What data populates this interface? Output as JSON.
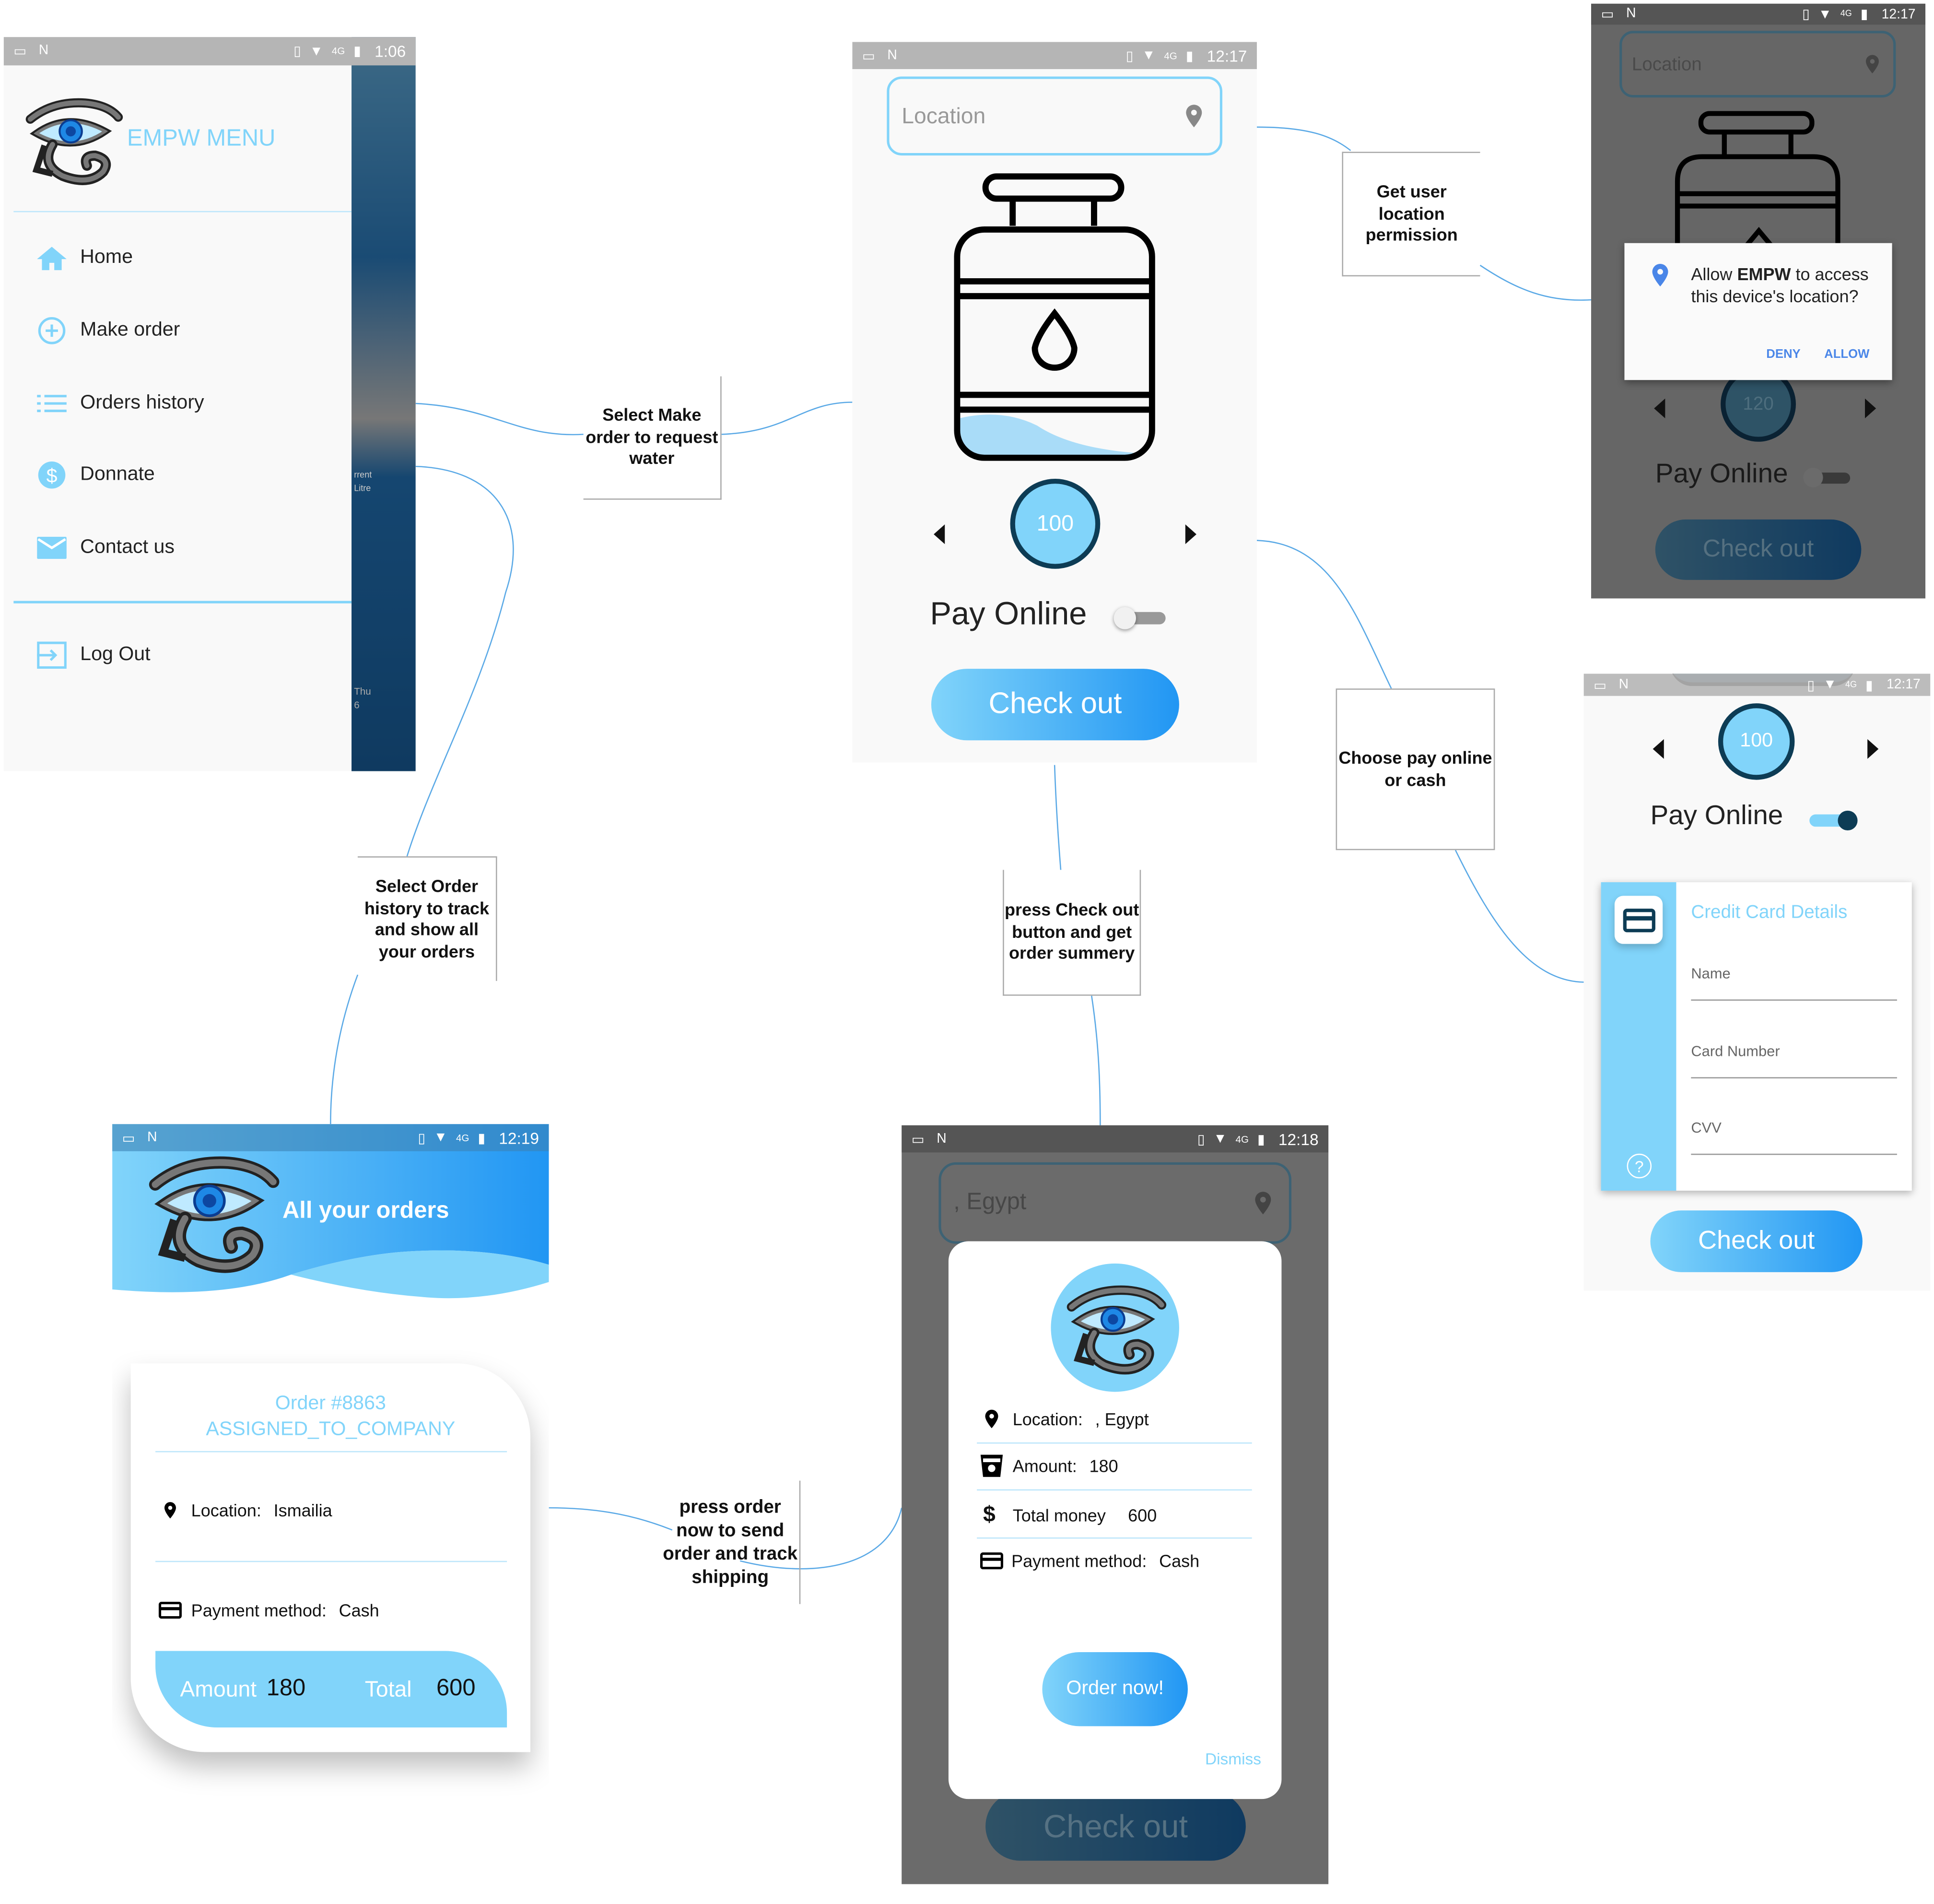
{
  "colors": {
    "accent": "#81d4fa",
    "primary": "#2196f3",
    "dark": "#0d3c55",
    "connector": "#5aa9e6",
    "overlay": "#666666"
  },
  "menu_screen": {
    "status": {
      "time": "1:06",
      "network": "4G"
    },
    "title": "EMPW MENU",
    "items": [
      {
        "label": "Home",
        "icon": "home-icon"
      },
      {
        "label": "Make order",
        "icon": "plus-circle-icon"
      },
      {
        "label": "Orders history",
        "icon": "list-icon"
      },
      {
        "label": "Donnate",
        "icon": "dollar-icon"
      },
      {
        "label": "Contact us",
        "icon": "mail-icon"
      }
    ],
    "logout": "Log Out",
    "background_peek": {
      "line1": "rrent",
      "line2": "Litre",
      "day": "Thu",
      "date": "6"
    }
  },
  "order_screen": {
    "status": {
      "time": "12:17",
      "network": "4G"
    },
    "location_placeholder": "Location",
    "quantity": "100",
    "pay_online_label": "Pay Online",
    "pay_online_on": false,
    "checkout": "Check out"
  },
  "permission_screen": {
    "status": {
      "time": "12:17",
      "network": "4G"
    },
    "location_placeholder": "Location",
    "quantity": "120",
    "pay_online_label": "Pay Online",
    "checkout": "Check out",
    "dialog": {
      "prefix": "Allow ",
      "app": "EMPW",
      "suffix": " to access this device's location?",
      "deny": "DENY",
      "allow": "ALLOW"
    }
  },
  "card_screen": {
    "status": {
      "time": "12:17",
      "network": "4G"
    },
    "quantity": "100",
    "pay_online_label": "Pay Online",
    "pay_online_on": true,
    "card_title": "Credit Card Details",
    "fields": [
      "Name",
      "Card Number",
      "CVV"
    ],
    "checkout": "Check out"
  },
  "history_screen": {
    "status": {
      "time": "12:19",
      "network": "4G"
    },
    "header": "All your orders",
    "order": {
      "title": "Order #8863",
      "status": "ASSIGNED_TO_COMPANY",
      "location_label": "Location:",
      "location": "Ismailia",
      "payment_label": "Payment method:",
      "payment": "Cash",
      "amount_label": "Amount",
      "amount": "180",
      "total_label": "Total",
      "total": "600"
    }
  },
  "summary_screen": {
    "status": {
      "time": "12:18",
      "network": "4G"
    },
    "location_value": ", Egypt",
    "checkout": "Check out",
    "dialog": {
      "location_label": "Location:",
      "location": ", Egypt",
      "amount_label": "Amount:",
      "amount": "180",
      "total_label": "Total money",
      "total": "600",
      "payment_label": "Payment method:",
      "payment": "Cash",
      "order_now": "Order now!",
      "dismiss": "Dismiss"
    }
  },
  "annotations": {
    "make_order": "Select  Make order to request water",
    "location_permission": "Get user location permission",
    "pay_choice": "Choose pay online or cash",
    "checkout": "press Check out button and get order summery",
    "history": "Select Order history to track and show all your orders",
    "order_now": "press order now to send order and track shipping"
  }
}
